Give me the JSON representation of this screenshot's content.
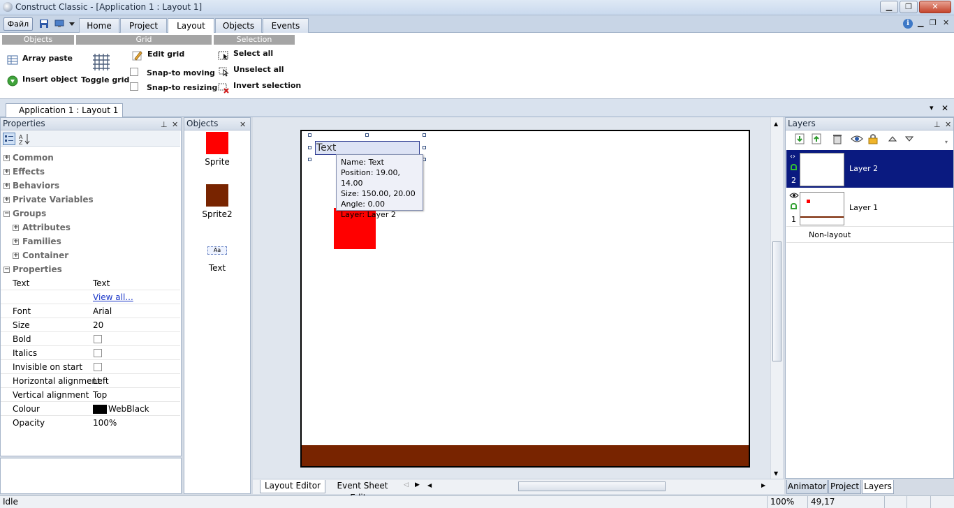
{
  "window": {
    "title": "Construct Classic - [Application 1 : Layout 1]",
    "minimize": "▁",
    "maximize": "❐",
    "close": "✕"
  },
  "ribbon": {
    "file_label": "Файл",
    "tabs": [
      "Home",
      "Project",
      "Layout",
      "Objects",
      "Events"
    ],
    "active_tab": "Layout",
    "right_controls": [
      "▁",
      "❐",
      "✕"
    ],
    "groups": {
      "objects": {
        "title": "Objects",
        "array_paste": "Array paste",
        "insert_object": "Insert object"
      },
      "grid": {
        "title": "Grid",
        "toggle_grid": "Toggle grid",
        "edit_grid": "Edit grid",
        "snap_moving": "Snap-to moving",
        "snap_resizing": "Snap-to resizing"
      },
      "selection": {
        "title": "Selection",
        "select_all": "Select all",
        "unselect_all": "Unselect all",
        "invert_selection": "Invert selection"
      }
    }
  },
  "document_tab": "Application 1 : Layout 1",
  "doc_strip_controls": [
    "▾",
    "✕"
  ],
  "properties_panel": {
    "title": "Properties",
    "categories": [
      "Common",
      "Effects",
      "Behaviors",
      "Private Variables",
      "Groups"
    ],
    "groups_children": [
      "Attributes",
      "Families",
      "Container"
    ],
    "properties_category": "Properties",
    "rows": [
      {
        "key": "Text",
        "value": "Text"
      },
      {
        "key": "",
        "value": "View all..."
      },
      {
        "key": "Font",
        "value": "Arial"
      },
      {
        "key": "Size",
        "value": "20"
      },
      {
        "key": "Bold",
        "value": ""
      },
      {
        "key": "Italics",
        "value": ""
      },
      {
        "key": "Invisible on start",
        "value": ""
      },
      {
        "key": "Horizontal alignment",
        "value": "Left"
      },
      {
        "key": "Vertical alignment",
        "value": "Top"
      },
      {
        "key": "Colour",
        "value": "WebBlack"
      },
      {
        "key": "Opacity",
        "value": "100%"
      }
    ]
  },
  "objects_panel": {
    "title": "Objects",
    "items": [
      {
        "name": "Sprite",
        "color": "#ff0000"
      },
      {
        "name": "Sprite2",
        "color": "#782400"
      },
      {
        "name": "Text",
        "color": ""
      }
    ]
  },
  "layout": {
    "text_object": "Text",
    "tooltip": {
      "name": "Name: Text",
      "position": "Position: 19.00, 14.00",
      "size": "Size: 150.00, 20.00",
      "angle": "Angle: 0.00",
      "layer": "Layer: Layer 2"
    },
    "sprite_color": "#ff0000",
    "ground_color": "#782400"
  },
  "editor_tabs": [
    "Layout Editor",
    "Event Sheet Editor"
  ],
  "layers_panel": {
    "title": "Layers",
    "layers": [
      {
        "name": "Layer 2",
        "number": "2",
        "selected": true
      },
      {
        "name": "Layer 1",
        "number": "1",
        "selected": false
      }
    ],
    "non_layout": "Non-layout"
  },
  "bottom_tabs": [
    "Animator",
    "Project",
    "Layers"
  ],
  "status_bar": {
    "text": "Idle",
    "zoom": "100%",
    "coords": "49,17"
  },
  "colors": {
    "selected_layer_bg": "#0a1a80",
    "colour_swatch": "#000000"
  }
}
